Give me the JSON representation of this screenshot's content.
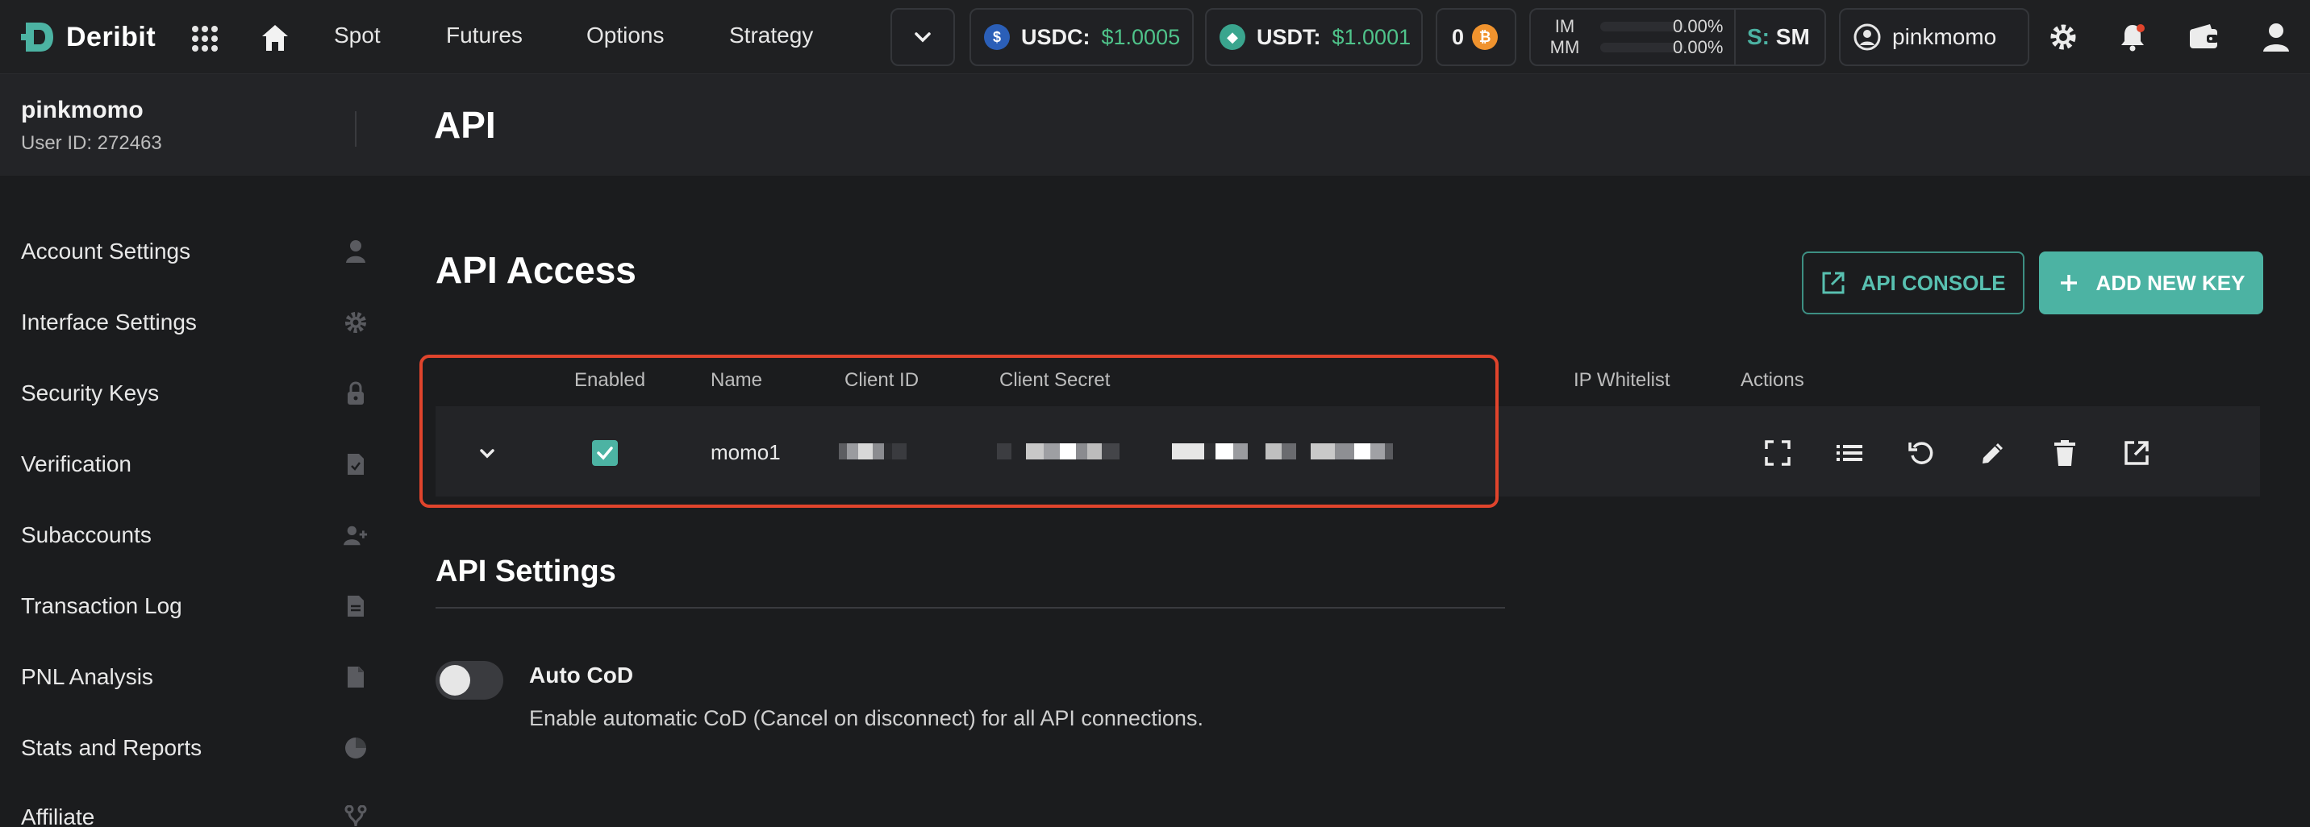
{
  "brand": {
    "name": "Deribit"
  },
  "nav": {
    "spot": "Spot",
    "futures": "Futures",
    "options": "Options",
    "strategy": "Strategy"
  },
  "balances": {
    "usdc": {
      "label": "USDC:",
      "value": "$1.0005"
    },
    "usdt": {
      "label": "USDT:",
      "value": "$1.0001"
    },
    "btc_count": "0"
  },
  "margin": {
    "im_label": "IM",
    "im_value": "0.00%",
    "mm_label": "MM",
    "mm_value": "0.00%"
  },
  "mode": {
    "prefix": "S:",
    "value": "SM"
  },
  "account": {
    "username": "pinkmomo"
  },
  "user": {
    "name": "pinkmomo",
    "id": "User ID: 272463"
  },
  "page": {
    "title": "API"
  },
  "sidebar": {
    "items": [
      {
        "label": "Account Settings",
        "icon": "user-icon"
      },
      {
        "label": "Interface Settings",
        "icon": "gear-icon"
      },
      {
        "label": "Security Keys",
        "icon": "lock-icon"
      },
      {
        "label": "Verification",
        "icon": "document-check-icon"
      },
      {
        "label": "Subaccounts",
        "icon": "users-add-icon"
      },
      {
        "label": "Transaction Log",
        "icon": "document-icon"
      },
      {
        "label": "PNL Analysis",
        "icon": "file-icon"
      },
      {
        "label": "Stats and Reports",
        "icon": "pie-chart-icon"
      },
      {
        "label": "Affiliate",
        "icon": "fork-icon"
      }
    ]
  },
  "api_access": {
    "title": "API Access",
    "console_button": "API CONSOLE",
    "add_button": "ADD NEW KEY",
    "columns": {
      "enabled": "Enabled",
      "name": "Name",
      "client_id": "Client ID",
      "client_secret": "Client Secret",
      "ip_whitelist": "IP Whitelist",
      "actions": "Actions"
    },
    "rows": [
      {
        "enabled": true,
        "name": "momo1"
      }
    ]
  },
  "api_settings": {
    "title": "API Settings",
    "auto_cod": {
      "title": "Auto CoD",
      "description": "Enable automatic CoD (Cancel on disconnect) for all API connections.",
      "enabled": false
    }
  },
  "colors": {
    "accent": "#4cb3a3",
    "positive": "#4fc38a",
    "highlight_border": "#e0442c",
    "background": "#1b1c1e"
  }
}
